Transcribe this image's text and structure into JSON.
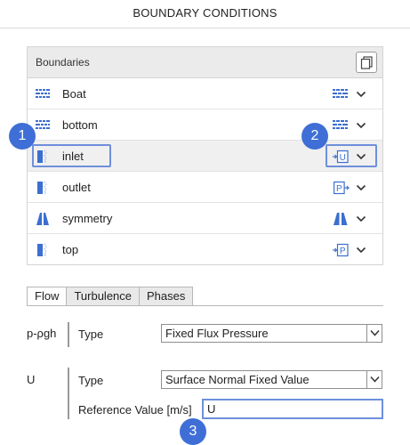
{
  "panel": {
    "title": "BOUNDARY CONDITIONS"
  },
  "boundaries": {
    "header": "Boundaries",
    "copy_icon": "copy-icon",
    "rows": [
      {
        "name": "Boat",
        "icon": "wall-icon",
        "type_icon": "wall-type-icon",
        "selected": false
      },
      {
        "name": "bottom",
        "icon": "wall-icon",
        "type_icon": "wall-type-icon",
        "selected": false
      },
      {
        "name": "inlet",
        "icon": "patch-icon",
        "type_icon": "velocity-inlet-icon",
        "type_letter": "U",
        "selected": true
      },
      {
        "name": "outlet",
        "icon": "patch-icon",
        "type_icon": "pressure-outlet-icon",
        "type_letter": "P",
        "selected": false
      },
      {
        "name": "symmetry",
        "icon": "symmetry-icon",
        "type_icon": "symmetry-type-icon",
        "selected": false
      },
      {
        "name": "top",
        "icon": "patch-icon",
        "type_icon": "pressure-inlet-icon",
        "type_letter": "P",
        "selected": false
      }
    ]
  },
  "callouts": [
    "1",
    "2",
    "3"
  ],
  "tabs": [
    {
      "label": "Flow",
      "active": true
    },
    {
      "label": "Turbulence",
      "active": false
    },
    {
      "label": "Phases",
      "active": false
    }
  ],
  "fields": {
    "p_rgh": {
      "label": "p-ρgh",
      "type_label": "Type",
      "type_value": "Fixed Flux Pressure"
    },
    "U": {
      "label": "U",
      "type_label": "Type",
      "type_value": "Surface Normal Fixed Value",
      "ref_label": "Reference Value [m/s]",
      "ref_value": "U"
    }
  },
  "colors": {
    "accent": "#3f6fd6",
    "highlight": "#6e8fdc",
    "icon_blue": "#3b6fd0"
  }
}
